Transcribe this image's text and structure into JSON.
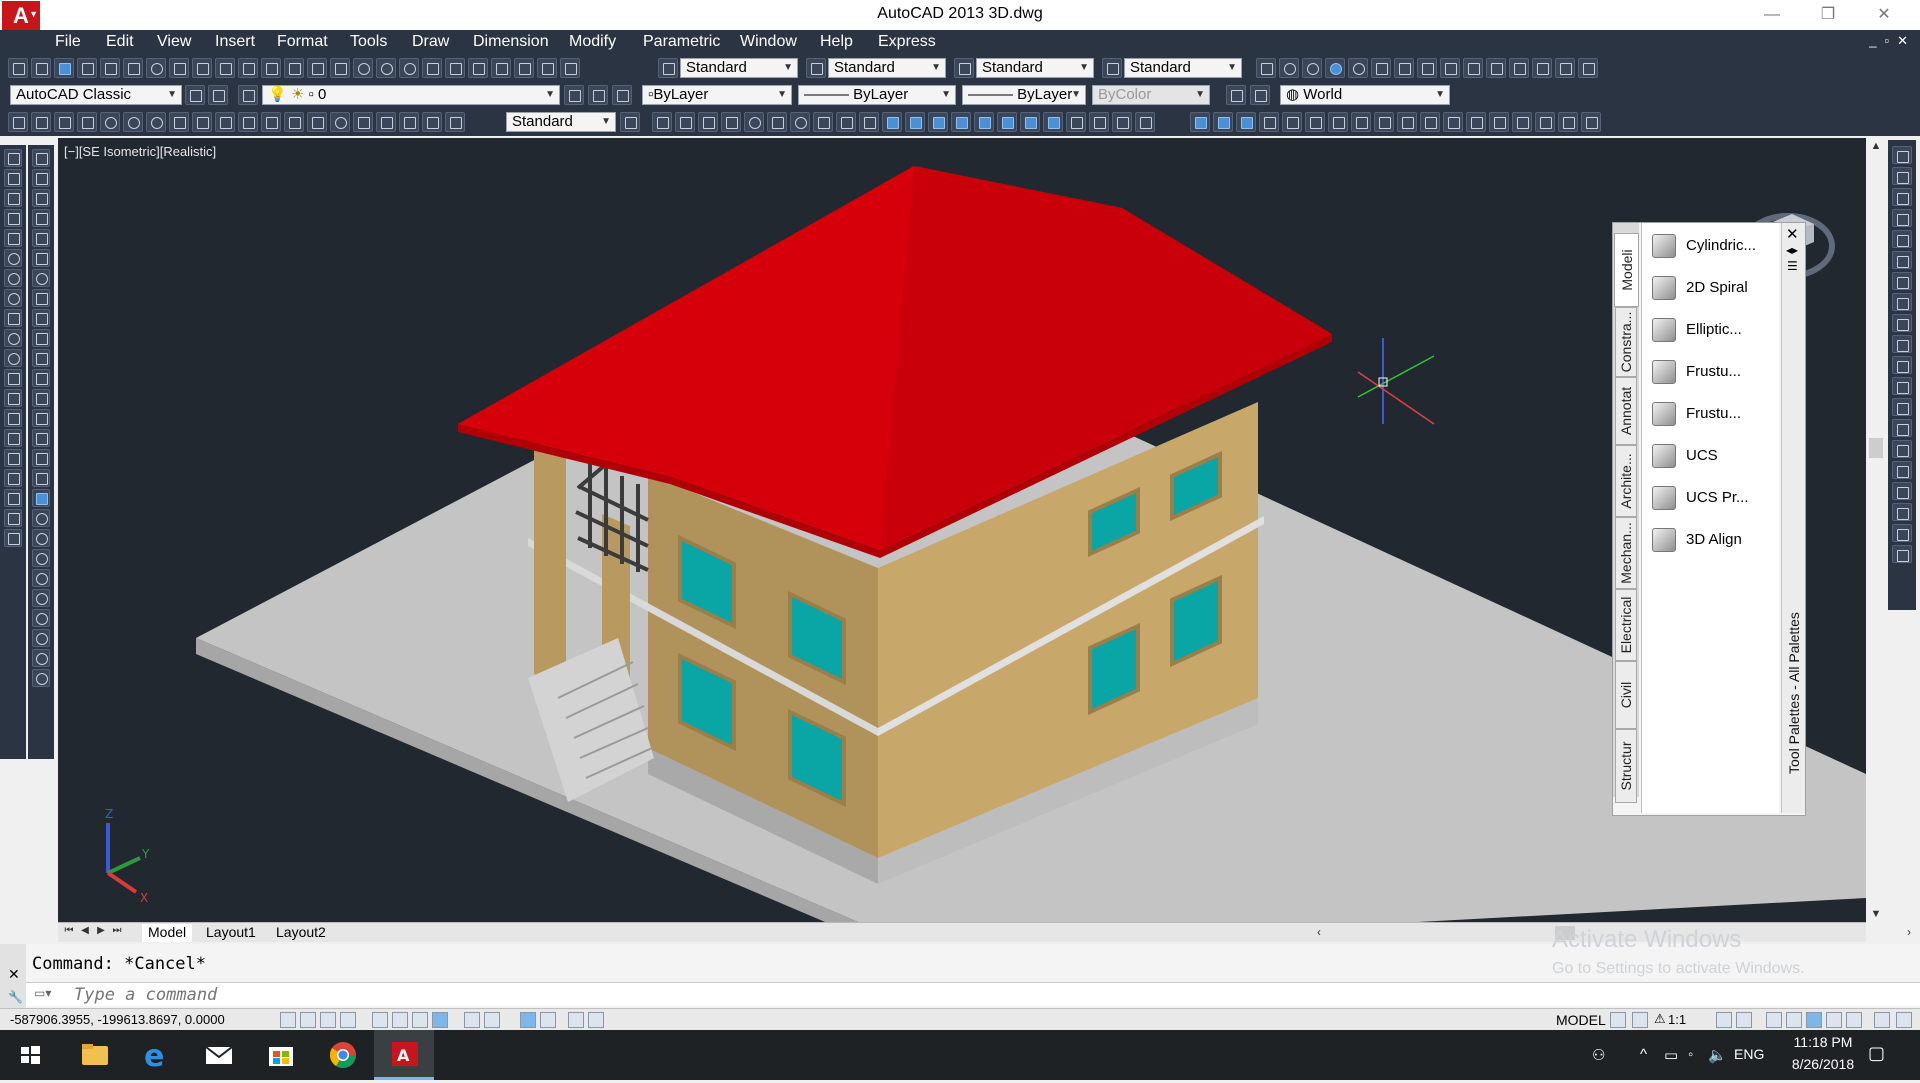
{
  "window": {
    "title": "AutoCAD 2013    3D.dwg",
    "app_logo": "A"
  },
  "menu": [
    "File",
    "Edit",
    "View",
    "Insert",
    "Format",
    "Tools",
    "Draw",
    "Dimension",
    "Modify",
    "Parametric",
    "Window",
    "Help",
    "Express"
  ],
  "toolbar1": {
    "text_style": "Standard",
    "dim_style": "Standard",
    "table_style": "Standard",
    "mleader_style": "Standard"
  },
  "toolbar2": {
    "workspace": "AutoCAD Classic",
    "layer": "0",
    "color": "ByLayer",
    "linetype": "ByLayer",
    "lineweight": "ByLayer",
    "plotstyle": "ByColor",
    "ucs": "World"
  },
  "toolbar3": {
    "dim_style": "Standard"
  },
  "viewport": {
    "label": "[−][SE Isometric][Realistic]"
  },
  "palette": {
    "tabs": [
      "Modeli",
      "Constra...",
      "Annotat",
      "Archite...",
      "Mechan...",
      "Electrical",
      "Civil",
      "Structur"
    ],
    "items": [
      "Cylindric...",
      "2D Spiral",
      "Elliptic...",
      "Frustu...",
      "Frustu...",
      "UCS",
      "UCS Pr...",
      "3D Align"
    ],
    "title": "Tool Palettes - All Palettes",
    "close_icon": "✕"
  },
  "layout_tabs": [
    "Model",
    "Layout1",
    "Layout2"
  ],
  "command": {
    "history": "Command: *Cancel*",
    "placeholder": "Type a command"
  },
  "watermark": {
    "line1": "Activate Windows",
    "line2": "Go to Settings to activate Windows."
  },
  "status": {
    "coords": "-587906.3955, -199613.8697, 0.0000",
    "space": "MODEL",
    "scale": "1:1"
  },
  "taskbar": {
    "lang": "ENG",
    "time": "11:18 PM",
    "date": "8/26/2018"
  },
  "colors": {
    "roof": "#e8000b",
    "walls": "#c8a86a",
    "windows": "#0aa5a5",
    "viewport_bg": "#212830",
    "ui_dark": "#2b3442"
  }
}
